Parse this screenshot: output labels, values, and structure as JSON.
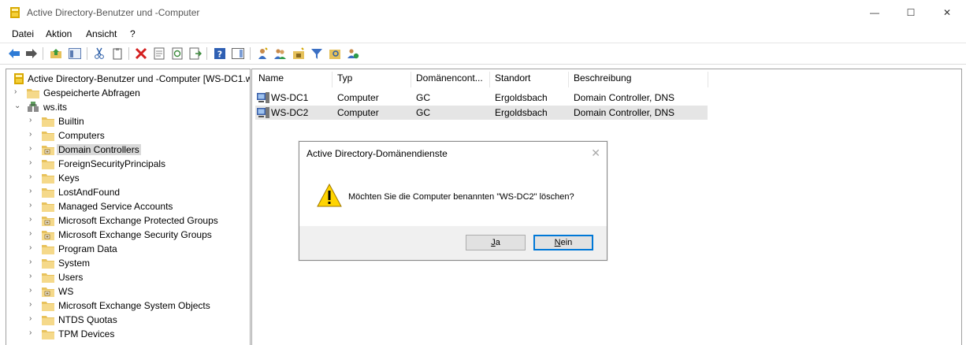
{
  "window": {
    "title": "Active Directory-Benutzer und -Computer",
    "minimize_glyph": "—",
    "maximize_glyph": "☐",
    "close_glyph": "✕"
  },
  "menu": [
    "Datei",
    "Aktion",
    "Ansicht",
    "?"
  ],
  "tree": {
    "root": "Active Directory-Benutzer und -Computer [WS-DC1.w",
    "saved_queries": "Gespeicherte Abfragen",
    "domain": "ws.its",
    "children": [
      {
        "label": "Builtin",
        "icon": "folder-icon"
      },
      {
        "label": "Computers",
        "icon": "folder-icon"
      },
      {
        "label": "Domain Controllers",
        "icon": "ou-folder-icon",
        "selected": true
      },
      {
        "label": "ForeignSecurityPrincipals",
        "icon": "folder-icon"
      },
      {
        "label": "Keys",
        "icon": "folder-icon"
      },
      {
        "label": "LostAndFound",
        "icon": "folder-icon"
      },
      {
        "label": "Managed Service Accounts",
        "icon": "folder-icon"
      },
      {
        "label": "Microsoft Exchange Protected Groups",
        "icon": "ou-folder-icon"
      },
      {
        "label": "Microsoft Exchange Security Groups",
        "icon": "ou-folder-icon"
      },
      {
        "label": "Program Data",
        "icon": "folder-icon"
      },
      {
        "label": "System",
        "icon": "folder-icon"
      },
      {
        "label": "Users",
        "icon": "folder-icon"
      },
      {
        "label": "WS",
        "icon": "ou-folder-icon"
      },
      {
        "label": "Microsoft Exchange System Objects",
        "icon": "folder-icon"
      },
      {
        "label": "NTDS Quotas",
        "icon": "folder-icon"
      },
      {
        "label": "TPM Devices",
        "icon": "folder-icon"
      }
    ]
  },
  "list": {
    "columns": [
      "Name",
      "Typ",
      "Domänencont...",
      "Standort",
      "Beschreibung"
    ],
    "rows": [
      {
        "name": "WS-DC1",
        "type": "Computer",
        "dc": "GC",
        "site": "Ergoldsbach",
        "desc": "Domain Controller, DNS"
      },
      {
        "name": "WS-DC2",
        "type": "Computer",
        "dc": "GC",
        "site": "Ergoldsbach",
        "desc": "Domain Controller, DNS",
        "selected": true
      }
    ]
  },
  "dialog": {
    "title": "Active Directory-Domänendienste",
    "message": "Möchten Sie die Computer benannten \"WS-DC2\" löschen?",
    "yes": {
      "mnemonic": "J",
      "rest": "a"
    },
    "no": {
      "mnemonic": "N",
      "rest": "ein"
    },
    "close_glyph": "✕"
  }
}
